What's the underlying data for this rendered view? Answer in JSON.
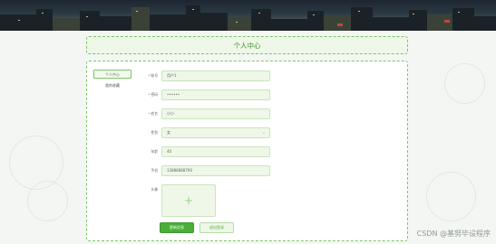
{
  "page": {
    "title": "个人中心"
  },
  "sidebar": {
    "items": [
      {
        "label": "个人中心",
        "active": true
      },
      {
        "label": "我的收藏",
        "active": false
      }
    ]
  },
  "form": {
    "fields": [
      {
        "label": "账号",
        "required": true,
        "value": "用户1"
      },
      {
        "label": "密码",
        "required": true,
        "value": "••••••"
      },
      {
        "label": "姓名",
        "required": true,
        "value": "小小"
      },
      {
        "label": "性别",
        "required": false,
        "value": "女",
        "type": "select"
      },
      {
        "label": "年龄",
        "required": false,
        "value": "40"
      },
      {
        "label": "手机",
        "required": false,
        "value": "13888888790"
      },
      {
        "label": "头像",
        "required": false,
        "type": "upload"
      }
    ],
    "upload_icon": "plus-icon",
    "update_button": "更新信息",
    "logout_button": "退出登录"
  },
  "watermark": "CSDN @基努毕设程序",
  "colors": {
    "accent": "#4cae3a",
    "field_bg": "#eef7e8",
    "border": "#7ec36a"
  }
}
